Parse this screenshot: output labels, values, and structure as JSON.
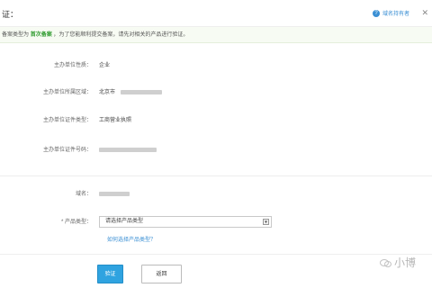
{
  "header": {
    "title": "证：",
    "help_link": "域名持有者",
    "help_icon": "help-icon",
    "close_icon": "close-icon"
  },
  "notice": {
    "prefix": "备案类型为",
    "highlight": "首次备案",
    "suffix": "，为了您能顺利提交备案，请先对相关的产品进行验证。"
  },
  "info_rows": [
    {
      "label": "主办单位性质：",
      "value": "企业"
    },
    {
      "label": "主办单位所属区域：",
      "value": "北京市"
    },
    {
      "label": "主办单位证件类型：",
      "value": "工商营业执照"
    },
    {
      "label": "主办单位证件号码：",
      "value": ""
    }
  ],
  "domain": {
    "label": "域名："
  },
  "product_type": {
    "label": "* 产品类型：",
    "selected": "请选择产品类型",
    "help_link": "如何选择产品类型？"
  },
  "buttons": {
    "verify": "验证",
    "back": "返回"
  },
  "watermark": {
    "text": "小博"
  }
}
